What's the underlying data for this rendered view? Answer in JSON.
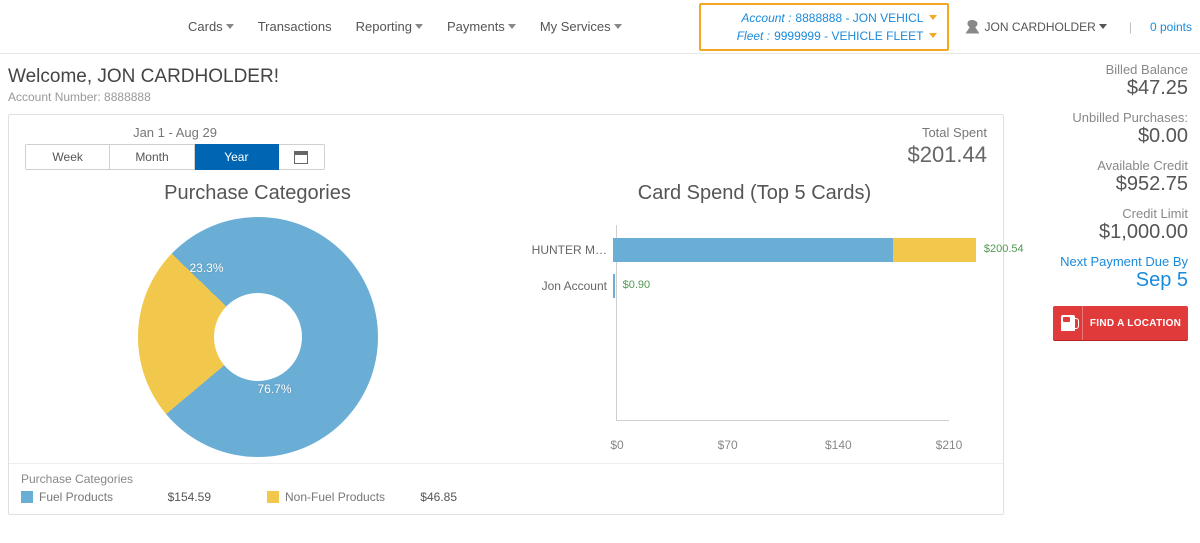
{
  "nav": {
    "items": [
      "Cards",
      "Transactions",
      "Reporting",
      "Payments",
      "My Services"
    ],
    "has_caret": [
      true,
      false,
      true,
      true,
      true
    ]
  },
  "context": {
    "account_label": "Account",
    "account_value": "8888888 - JON VEHICL",
    "fleet_label": "Fleet",
    "fleet_value": "9999999 - VEHICLE FLEET"
  },
  "user": {
    "name": "JON CARDHOLDER",
    "points": "0 points"
  },
  "welcome": {
    "greeting": "Welcome, JON CARDHOLDER!",
    "acct_prefix": "Account Number: ",
    "acct_number": "8888888"
  },
  "dash": {
    "range_label": "Jan 1 - Aug 29",
    "segs": {
      "week": "Week",
      "month": "Month",
      "year": "Year"
    },
    "total_label": "Total Spent",
    "total_value": "$201.44",
    "donut": {
      "title": "Purchase Categories",
      "p1": "76.7%",
      "p2": "23.3%",
      "c1": "#6aaed6",
      "c2": "#f1c84c"
    },
    "bar": {
      "title": "Card Spend (Top 5 Cards)",
      "rows": [
        {
          "cat": "HUNTER M…",
          "val": "$200.54"
        },
        {
          "cat": "Jon Account",
          "val": "$0.90"
        }
      ],
      "xticks": [
        "$0",
        "$70",
        "$140",
        "$210"
      ]
    },
    "legend": {
      "title": "Purchase Categories",
      "items": [
        {
          "swatch": "#6aaed6",
          "label": "Fuel Products",
          "value": "$154.59"
        },
        {
          "swatch": "#f1c84c",
          "label": "Non-Fuel Products",
          "value": "$46.85"
        }
      ]
    }
  },
  "side": {
    "billed_label": "Billed Balance",
    "billed_value": "$47.25",
    "unbilled_label": "Unbilled Purchases:",
    "unbilled_value": "$0.00",
    "avail_label": "Available Credit",
    "avail_value": "$952.75",
    "limit_label": "Credit Limit",
    "limit_value": "$1,000.00",
    "nextpay_label": "Next Payment Due By",
    "nextpay_value": "Sep 5",
    "find_loc": "FIND A LOCATION"
  },
  "chart_data": [
    {
      "type": "pie",
      "title": "Purchase Categories",
      "categories": [
        "Fuel Products",
        "Non-Fuel Products"
      ],
      "values": [
        76.7,
        23.3
      ],
      "amounts": [
        154.59,
        46.85
      ],
      "colors": [
        "#6aaed6",
        "#f1c84c"
      ]
    },
    {
      "type": "bar",
      "title": "Card Spend (Top 5 Cards)",
      "orientation": "horizontal",
      "categories": [
        "HUNTER M…",
        "Jon Account"
      ],
      "series": [
        {
          "name": "Fuel Products",
          "values": [
            154.59,
            0.9
          ],
          "color": "#6aaed6"
        },
        {
          "name": "Non-Fuel Products",
          "values": [
            45.95,
            0.0
          ],
          "color": "#f1c84c"
        }
      ],
      "totals": [
        200.54,
        0.9
      ],
      "xlabel": "",
      "xlim": [
        0,
        210
      ],
      "xticks": [
        0,
        70,
        140,
        210
      ]
    }
  ]
}
